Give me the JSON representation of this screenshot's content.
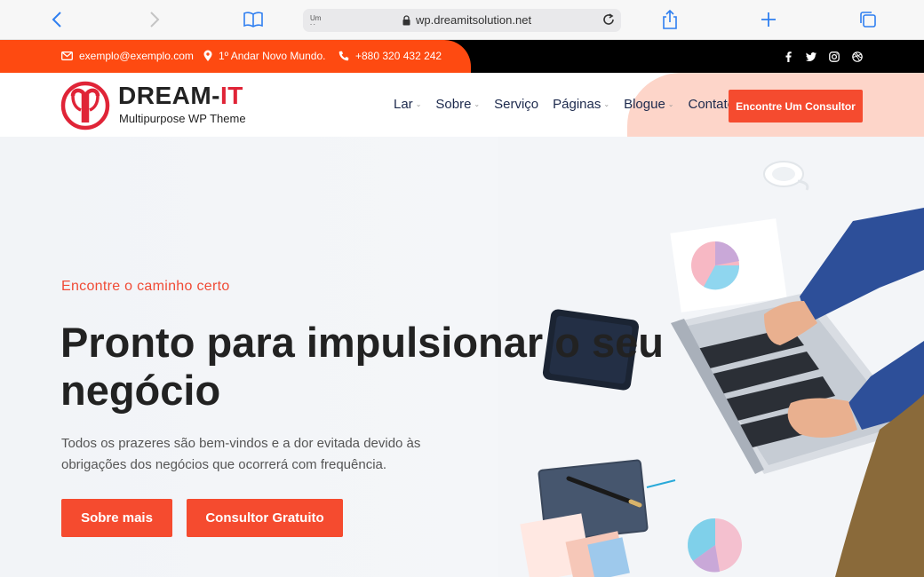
{
  "browser": {
    "address_mini_text": "Um Ho",
    "url": "wp.dreamitsolution.net"
  },
  "topbar": {
    "email": "exemplo@exemplo.com",
    "address": "1º Andar Novo Mundo.",
    "phone": "+880 320 432 242",
    "social_icons": [
      "facebook-icon",
      "twitter-icon",
      "instagram-icon",
      "dribbble-icon"
    ]
  },
  "header": {
    "logo_main": "DREAM-",
    "logo_accent": "IT",
    "logo_sub": "Multipurpose WP Theme",
    "nav": [
      {
        "label": "Lar",
        "has_dropdown": true
      },
      {
        "label": "Sobre",
        "has_dropdown": true
      },
      {
        "label": "Serviço",
        "has_dropdown": false
      },
      {
        "label": "Páginas",
        "has_dropdown": true
      },
      {
        "label": "Blogue",
        "has_dropdown": true
      },
      {
        "label": "Contato",
        "has_dropdown": false
      }
    ],
    "cta_label": "Encontre Um Consultor"
  },
  "hero": {
    "eyebrow": "Encontre o caminho certo",
    "headline": "Pronto para impulsionar o seu negócio",
    "description": "Todos os prazeres são bem-vindos e a dor evitada devido às obrigações dos negócios que ocorrerá com frequência.",
    "primary_button": "Sobre mais",
    "secondary_button": "Consultor Gratuito"
  },
  "colors": {
    "accent": "#f54b2f",
    "topbar_orange": "#fe4a11",
    "header_pink": "#fdd5c9",
    "nav_text": "#1d2a4d",
    "logo_red": "#e02437"
  }
}
